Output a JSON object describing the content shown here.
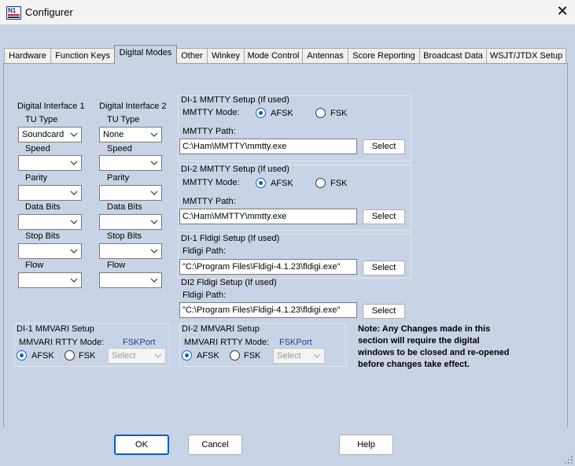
{
  "window": {
    "title": "Configurer",
    "icon_text": "N1"
  },
  "tabs": [
    "Hardware",
    "Function Keys",
    "Digital Modes",
    "Other",
    "Winkey",
    "Mode Control",
    "Antennas",
    "Score Reporting",
    "Broadcast Data",
    "WSJT/JTDX Setup"
  ],
  "active_tab": "Digital Modes",
  "di1": {
    "header": "Digital Interface 1",
    "tu_type_label": "TU Type",
    "tu_type_value": "Soundcard",
    "speed_label": "Speed",
    "parity_label": "Parity",
    "data_bits_label": "Data Bits",
    "stop_bits_label": "Stop Bits",
    "flow_label": "Flow"
  },
  "di2": {
    "header": "Digital Interface 2",
    "tu_type_label": "TU Type",
    "tu_type_value": "None",
    "speed_label": "Speed",
    "parity_label": "Parity",
    "data_bits_label": "Data Bits",
    "stop_bits_label": "Stop Bits",
    "flow_label": "Flow"
  },
  "mmtty1": {
    "title": "DI-1 MMTTY Setup (If used)",
    "mode_label": "MMTTY Mode:",
    "afsk": "AFSK",
    "fsk": "FSK",
    "selected": "AFSK",
    "path_label": "MMTTY Path:",
    "path": "C:\\Ham\\MMTTY\\mmtty.exe",
    "select": "Select"
  },
  "mmtty2": {
    "title": "DI-2 MMTTY Setup (If used)",
    "mode_label": "MMTTY Mode:",
    "afsk": "AFSK",
    "fsk": "FSK",
    "selected": "AFSK",
    "path_label": "MMTTY Path:",
    "path": "C:\\Ham\\MMTTY\\mmtty.exe",
    "select": "Select"
  },
  "fldigi1": {
    "title": "DI-1 Fldigi Setup (If used)",
    "path_label": "Fldigi Path:",
    "path": "\"C:\\Program Files\\Fldigi-4.1.23\\fldigi.exe\"",
    "select": "Select"
  },
  "fldigi2": {
    "title": "DI2 Fldigi Setup (If used)",
    "path_label": "Fldigi Path:",
    "path": "\"C:\\Program Files\\Fldigi-4.1.23\\fldigi.exe\"",
    "select": "Select"
  },
  "mmvari1": {
    "title": "DI-1 MMVARI Setup",
    "mode_label": "MMVARI RTTY Mode:",
    "port_label": "FSKPort",
    "afsk": "AFSK",
    "fsk": "FSK",
    "selected": "AFSK",
    "port_value": "Select"
  },
  "mmvari2": {
    "title": "DI-2 MMVARI Setup",
    "mode_label": "MMVARI RTTY Mode:",
    "port_label": "FSKPort",
    "afsk": "AFSK",
    "fsk": "FSK",
    "selected": "AFSK",
    "port_value": "Select"
  },
  "note": [
    "Note: Any Changes made in this",
    "section will require the digital",
    "windows to be closed and re-opened",
    "before changes take effect."
  ],
  "buttons": {
    "ok": "OK",
    "cancel": "Cancel",
    "help": "Help"
  },
  "colors": {
    "panel": "#c8d4e6",
    "accent": "#0a5fc2",
    "fsk_port": "#1f3f8f"
  }
}
